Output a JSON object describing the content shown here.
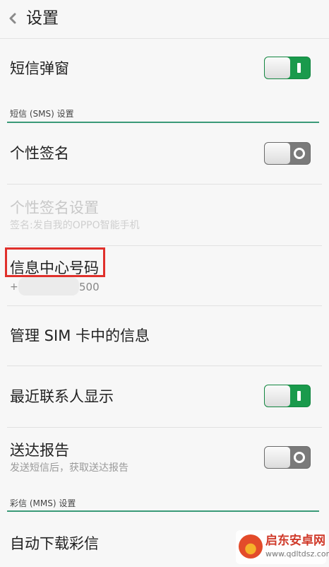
{
  "header": {
    "title": "设置"
  },
  "rows": {
    "sms_popup": {
      "label": "短信弹窗",
      "toggle": "on"
    },
    "signature": {
      "label": "个性签名",
      "toggle": "off"
    },
    "signature_settings": {
      "label": "个性签名设置",
      "sub": "签名:发自我的OPPO智能手机"
    },
    "service_center": {
      "label": "信息中心号码",
      "sub_prefix": "+",
      "sub_suffix": "500"
    },
    "manage_sim": {
      "label": "管理 SIM 卡中的信息"
    },
    "recent_contacts": {
      "label": "最近联系人显示",
      "toggle": "on"
    },
    "delivery_report": {
      "label": "送达报告",
      "sub": "发送短信后，获取送达报告",
      "toggle": "off"
    },
    "auto_download_mms": {
      "label": "自动下载彩信"
    }
  },
  "sections": {
    "sms": {
      "title": "短信 (SMS) 设置"
    },
    "mms": {
      "title": "彩信 (MMS) 设置"
    }
  },
  "watermark": {
    "name": "启东安卓网",
    "url": "www.qdltdsz.com"
  },
  "colors": {
    "accent": "#3a9a78",
    "toggle_on": "#1a9a4c",
    "toggle_off": "#7a7a7a",
    "highlight": "#e0302b"
  }
}
